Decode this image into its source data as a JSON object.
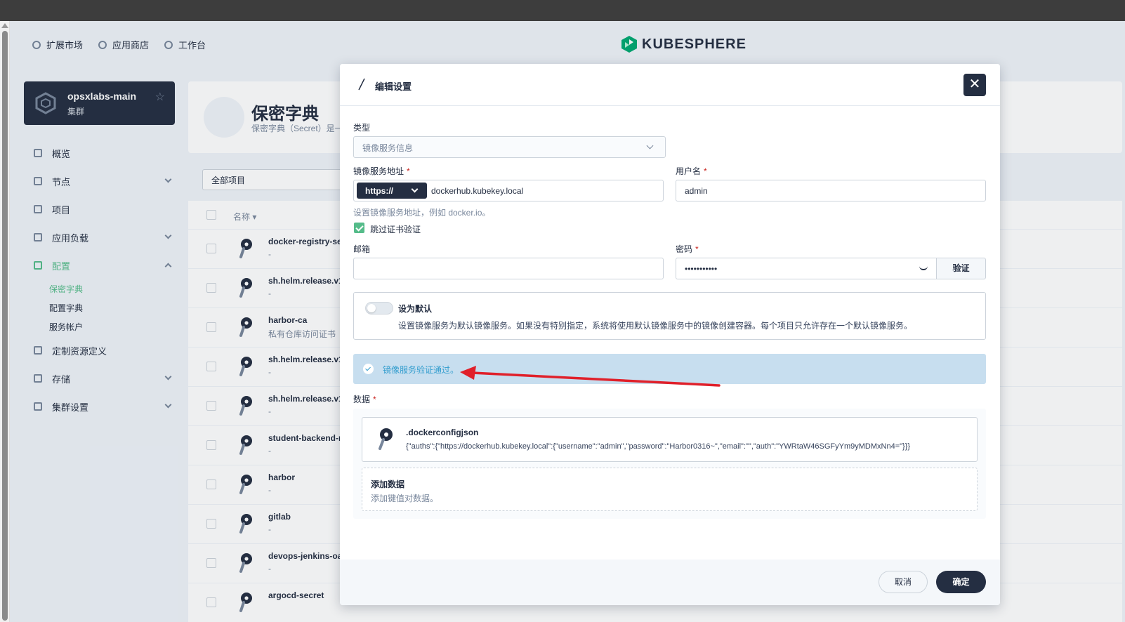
{
  "header": {
    "nav": [
      "扩展市场",
      "应用商店",
      "工作台"
    ],
    "logo": "KUBESPHERE"
  },
  "cluster": {
    "name": "opsxlabs-main",
    "type": "集群"
  },
  "sidebar": {
    "items": [
      {
        "label": "概览"
      },
      {
        "label": "节点"
      },
      {
        "label": "项目"
      },
      {
        "label": "应用负载"
      },
      {
        "label": "配置"
      },
      {
        "label": "定制资源定义"
      },
      {
        "label": "存储"
      },
      {
        "label": "集群设置"
      }
    ],
    "config_sub": [
      "保密字典",
      "配置字典",
      "服务帐户"
    ]
  },
  "page": {
    "title": "保密字典",
    "desc": "保密字典（Secret）是一",
    "filter": "全部项目",
    "col_name": "名称 ▾",
    "rows": [
      {
        "name": "docker-registry-sec",
        "sub": "-"
      },
      {
        "name": "sh.helm.release.v1",
        "sub": "-"
      },
      {
        "name": "harbor-ca",
        "sub": "私有仓库访问证书"
      },
      {
        "name": "sh.helm.release.v1",
        "sub": "-"
      },
      {
        "name": "sh.helm.release.v1",
        "sub": "-"
      },
      {
        "name": "student-backend-re",
        "sub": "-"
      },
      {
        "name": "harbor",
        "sub": "-"
      },
      {
        "name": "gitlab",
        "sub": "-"
      },
      {
        "name": "devops-jenkins-oau",
        "sub": "-"
      },
      {
        "name": "argocd-secret",
        "sub": ""
      }
    ]
  },
  "modal": {
    "title": "编辑设置",
    "close": "✕",
    "type_label": "类型",
    "type_value": "镜像服务信息",
    "registry_label": "镜像服务地址",
    "required_mark": "*",
    "protocol": "https://",
    "registry_value": "dockerhub.kubekey.local",
    "registry_hint": "设置镜像服务地址，例如 docker.io。",
    "username_label": "用户名",
    "username_value": "admin",
    "skip_tls_label": "跳过证书验证",
    "email_label": "邮箱",
    "email_value": "",
    "password_label": "密码",
    "password_value": "•••••••••••",
    "verify_label": "验证",
    "default_title": "设为默认",
    "default_desc": "设置镜像服务为默认镜像服务。如果没有特别指定，系统将使用默认镜像服务中的镜像创建容器。每个项目只允许存在一个默认镜像服务。",
    "alert_text": "镜像服务验证通过。",
    "data_label": "数据",
    "data_key": ".dockerconfigjson",
    "data_value": "{\"auths\":{\"https://dockerhub.kubekey.local\":{\"username\":\"admin\",\"password\":\"Harbor0316~\",\"email\":\"\",\"auth\":\"YWRtaW46SGFyYm9yMDMxNn4=\"}}}",
    "add_title": "添加数据",
    "add_desc": "添加键值对数据。",
    "cancel": "取消",
    "ok": "确定"
  },
  "colors": {
    "accent": "#55bc8a",
    "dark": "#242e42",
    "info": "#329dce",
    "annotation": "#e0202a"
  }
}
